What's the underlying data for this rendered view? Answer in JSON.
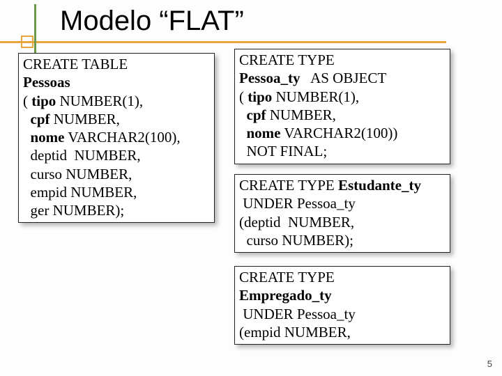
{
  "title": "Modelo “FLAT”",
  "page_number": "5",
  "left": {
    "l1a": "CREATE TABLE",
    "l1b": "Pessoas",
    "l2a": "( ",
    "l2b": "tipo",
    "l2c": " NUMBER(1),",
    "l3": "  cpf",
    "l3b": " NUMBER,",
    "l4": "  nome",
    "l4b": " VARCHAR2(100),",
    "l5": "  deptid  NUMBER,",
    "l6": "  curso NUMBER,",
    "l7": "  empid NUMBER,",
    "l8": "  ger NUMBER);"
  },
  "r1": {
    "l1": "CREATE TYPE",
    "l2a": "Pessoa_ty",
    "l2b": "   AS OBJECT",
    "l3a": "( ",
    "l3b": "tipo",
    "l3c": " NUMBER(1),",
    "l4a": "  cpf",
    "l4b": " NUMBER,",
    "l5a": "  nome",
    "l5b": " VARCHAR2(100))",
    "l6": "  NOT FINAL;"
  },
  "r2": {
    "l1a": "CREATE TYPE ",
    "l1b": "Estudante_ty",
    "l2": " UNDER Pessoa_ty",
    "l3": "(deptid  NUMBER,",
    "l4": "  curso NUMBER);"
  },
  "r3": {
    "l1": "CREATE TYPE",
    "l2": "Empregado_ty",
    "l3": " UNDER Pessoa_ty",
    "l4": "(empid NUMBER,"
  }
}
